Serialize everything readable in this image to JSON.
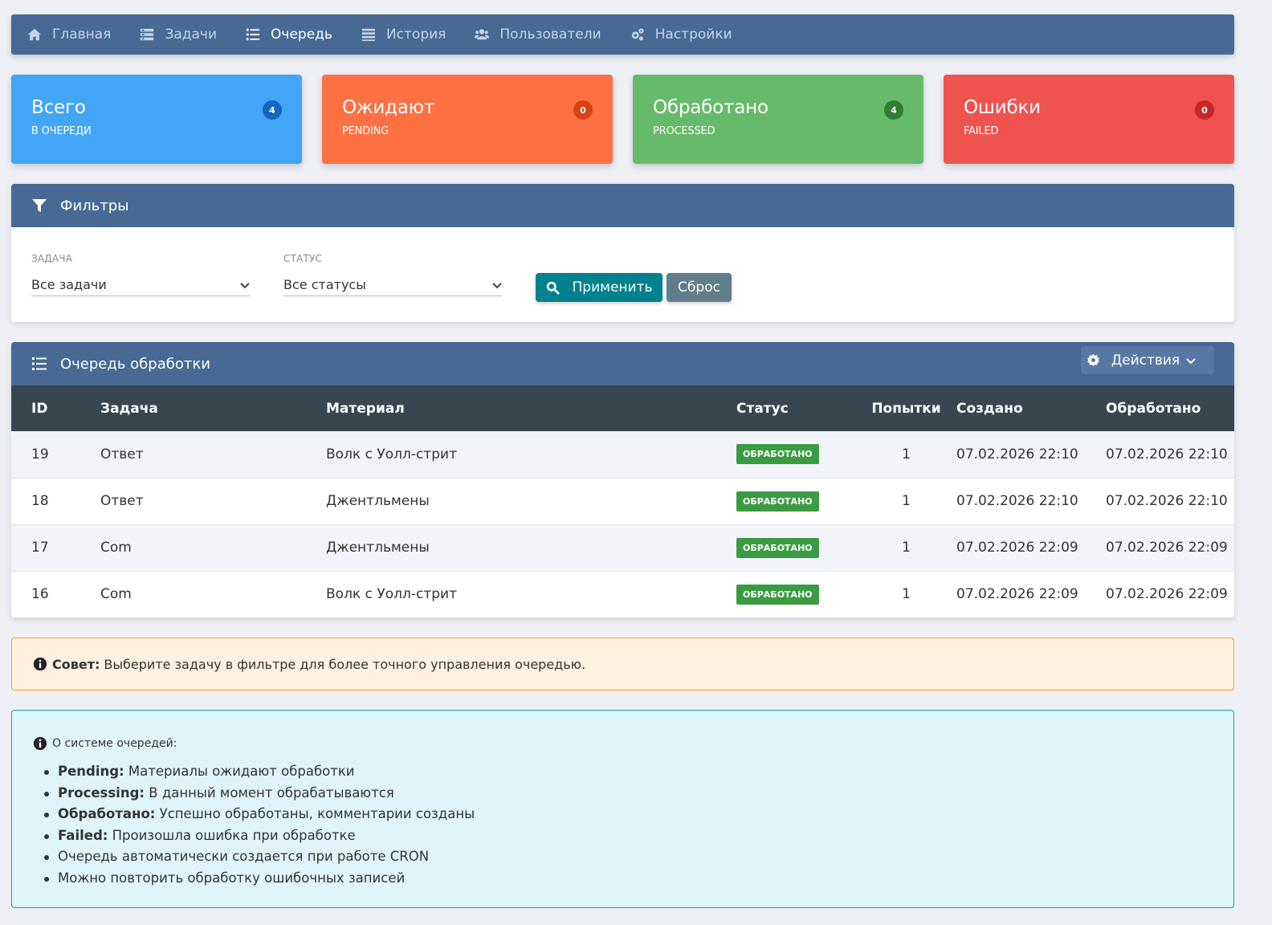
{
  "nav": {
    "items": [
      {
        "label": "Главная",
        "icon": "home-icon"
      },
      {
        "label": "Задачи",
        "icon": "tasks-icon"
      },
      {
        "label": "Очередь",
        "icon": "list-icon",
        "active": true
      },
      {
        "label": "История",
        "icon": "history-icon"
      },
      {
        "label": "Пользователи",
        "icon": "users-icon"
      },
      {
        "label": "Настройки",
        "icon": "gears-icon"
      }
    ]
  },
  "stats": [
    {
      "title": "Всего",
      "subtitle": "В ОЧЕРЕДИ",
      "count": "4",
      "color": "#42a5f5",
      "badge_color": "#1565c0"
    },
    {
      "title": "Ожидают",
      "subtitle": "PENDING",
      "count": "0",
      "color": "#ff7043",
      "badge_color": "#d84315"
    },
    {
      "title": "Обработано",
      "subtitle": "PROCESSED",
      "count": "4",
      "color": "#66bb6a",
      "badge_color": "#2e7d32"
    },
    {
      "title": "Ошибки",
      "subtitle": "FAILED",
      "count": "0",
      "color": "#ef5350",
      "badge_color": "#c62828"
    }
  ],
  "filters": {
    "title": "Фильтры",
    "task_label": "ЗАДАЧА",
    "task_value": "Все задачи",
    "status_label": "СТАТУС",
    "status_value": "Все статусы",
    "apply_label": "Применить",
    "reset_label": "Сброс"
  },
  "queue": {
    "title": "Очередь обработки",
    "actions_label": "Действия",
    "columns": [
      "ID",
      "Задача",
      "Материал",
      "Статус",
      "Попытки",
      "Создано",
      "Обработано"
    ],
    "rows": [
      {
        "id": "19",
        "task": "Ответ",
        "material": "Волк с Уолл-стрит",
        "status": "ОБРАБОТАНО",
        "attempts": "1",
        "created": "07.02.2026 22:10",
        "processed": "07.02.2026 22:10"
      },
      {
        "id": "18",
        "task": "Ответ",
        "material": "Джентльмены",
        "status": "ОБРАБОТАНО",
        "attempts": "1",
        "created": "07.02.2026 22:10",
        "processed": "07.02.2026 22:10"
      },
      {
        "id": "17",
        "task": "Com",
        "material": "Джентльмены",
        "status": "ОБРАБОТАНО",
        "attempts": "1",
        "created": "07.02.2026 22:09",
        "processed": "07.02.2026 22:09"
      },
      {
        "id": "16",
        "task": "Com",
        "material": "Волк с Уолл-стрит",
        "status": "ОБРАБОТАНО",
        "attempts": "1",
        "created": "07.02.2026 22:09",
        "processed": "07.02.2026 22:09"
      }
    ]
  },
  "tip": {
    "bold": "Совет:",
    "text": "Выберите задачу в фильтре для более точного управления очередью."
  },
  "info": {
    "title": "О системе очередей:",
    "items": [
      {
        "bold": "Pending:",
        "text": "Материалы ожидают обработки"
      },
      {
        "bold": "Processing:",
        "text": "В данный момент обрабатываются"
      },
      {
        "bold": "Обработано:",
        "text": "Успешно обработаны, комментарии созданы"
      },
      {
        "bold": "Failed:",
        "text": "Произошла ошибка при обработке"
      },
      {
        "bold": "",
        "text": "Очередь автоматически создается при работе CRON"
      },
      {
        "bold": "",
        "text": "Можно повторить обработку ошибочных записей"
      }
    ]
  }
}
